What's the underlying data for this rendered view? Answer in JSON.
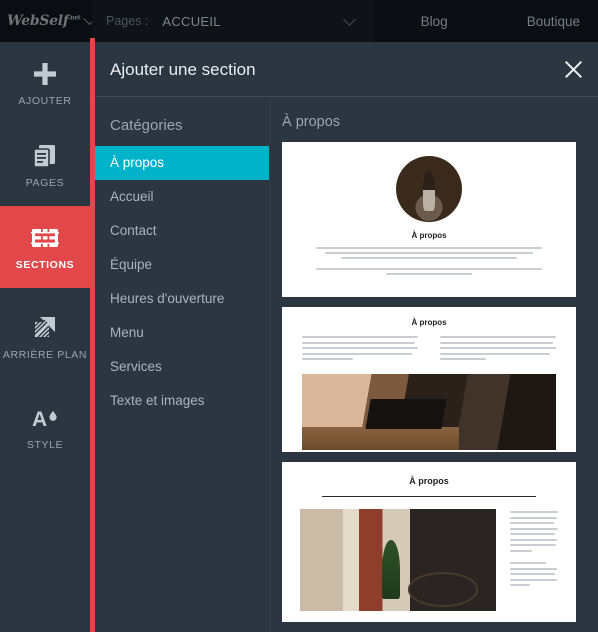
{
  "topbar": {
    "logo": "WebSelf",
    "logo_suffix": ".net",
    "pages_label": "Pages :",
    "pages_value": "ACCUEIL",
    "links": [
      "Blog",
      "Boutique"
    ]
  },
  "leftnav": {
    "items": [
      {
        "label": "AJOUTER",
        "icon": "plus-icon",
        "active": false
      },
      {
        "label": "PAGES",
        "icon": "pages-icon",
        "active": false
      },
      {
        "label": "SECTIONS",
        "icon": "sections-icon",
        "active": true
      },
      {
        "label": "ARRIÈRE PLAN",
        "icon": "background-icon",
        "active": false
      },
      {
        "label": "STYLE",
        "icon": "style-icon",
        "active": false
      }
    ]
  },
  "modal": {
    "title": "Ajouter une section",
    "close_icon": "close-icon",
    "categories_heading": "Catégories",
    "categories": [
      "À propos",
      "Accueil",
      "Contact",
      "Équipe",
      "Heures d'ouverture",
      "Menu",
      "Services",
      "Texte et images"
    ],
    "selected_category": "À propos",
    "preview_heading": "À propos",
    "templates": [
      {
        "name": "about-centered-circle-photo",
        "title": "À propos"
      },
      {
        "name": "about-two-columns-with-image",
        "title": "À propos"
      },
      {
        "name": "about-image-left-text-right",
        "title": "À propos"
      }
    ]
  },
  "colors": {
    "accent_red": "#e2484a",
    "accent_teal": "#00b3c8",
    "panel_dark": "#2b3640",
    "topbar_dark": "#0b0f13"
  }
}
